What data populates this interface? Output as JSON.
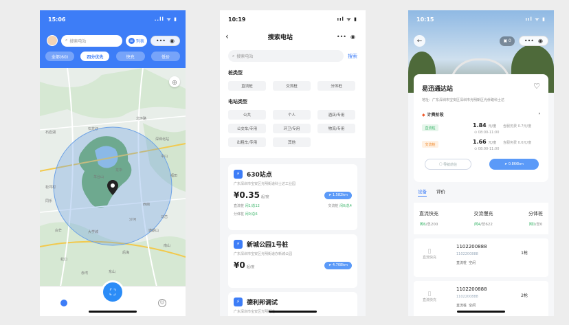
{
  "phone1": {
    "time": "15:06",
    "signal": "..ll ᯤ ▮",
    "search_placeholder": "搜索电站",
    "list_label": "列表",
    "tabs": [
      "全部(60)",
      "四分优先",
      "快充",
      "低价"
    ],
    "map_labels": [
      "石岩湖",
      "石龙仔",
      "北环路",
      "深圳北站",
      "平山",
      "西丽",
      "大学城",
      "塘朗山",
      "南山",
      "同乐",
      "蛇口",
      "赤湾",
      "白芒",
      "羊台山",
      "福田",
      "龙华",
      "沙河",
      "后海",
      "松坪村",
      "东山",
      "马峦"
    ],
    "nav_left": "首页",
    "nav_right": "我的"
  },
  "phone2": {
    "time": "10:19",
    "signal": "ııl ᯤ ▮",
    "title": "搜索电站",
    "search_placeholder": "搜索电站",
    "search_btn": "搜索",
    "pile_type_title": "桩类型",
    "pile_types": [
      "直流桩",
      "交流桩",
      "分体桩"
    ],
    "station_type_title": "电站类型",
    "station_types": [
      "公共",
      "个人",
      "酒店/专用",
      "公交车/专用",
      "环卫/专用",
      "物流/专用",
      "出租车/专用",
      "其他"
    ],
    "cards": [
      {
        "name": "630站点",
        "addr": "广东深圳市宝安区光明街道科士达工业园",
        "price": "¥0.35",
        "unit": "起/度",
        "nav": "1.582km",
        "dc": "直流桩",
        "dc_val": "闲1/总12",
        "ac": "交流桩",
        "ac_val": "闲0/总4",
        "split": "分体桩",
        "split_val": "闲0/总6"
      },
      {
        "name": "新城公园1号桩",
        "addr": "广东深圳市宝安区光明街道办新城公园",
        "price": "¥0",
        "unit": "起/度",
        "nav": "4.708km"
      },
      {
        "name": "德利邦调试",
        "addr": "广东深圳市宝安区光明街道"
      }
    ]
  },
  "phone3": {
    "time": "10:15",
    "signal": "ııl ᯤ ▮",
    "img_count": "0",
    "station_name": "易迅通达站",
    "address": "地址：广东深圳市宝安区深圳市光明新区光侨路科士达",
    "fee_label": "计费阶段",
    "prices": [
      {
        "badge": "直流桩",
        "price": "1.84",
        "unit": "元/度",
        "service": "含服务费 0.7元/度",
        "time": "08:00-11:00"
      },
      {
        "badge": "交流桩",
        "price": "1.66",
        "unit": "元/度",
        "service": "含服务费 0.6元/度",
        "time": "08:00-11:00"
      }
    ],
    "btn_left": "导航前往",
    "btn_right": "0.866km",
    "tabs": [
      "设备",
      "评价"
    ],
    "stats": [
      {
        "label": "直流快充",
        "val_hl": "闲6",
        "val": "/总200"
      },
      {
        "label": "交流慢充",
        "val_hl": "闲4",
        "val": "/总622"
      },
      {
        "label": "分体桩",
        "val_hl": "闲0",
        "val": "/总0"
      }
    ],
    "piles": [
      {
        "no": "1102200888",
        "sub": "1102200888",
        "type": "直流桩",
        "status": "空闲",
        "guns": "1枪",
        "icon_label": "直流快充"
      },
      {
        "no": "1102200888",
        "sub": "1102200888",
        "type": "直流桩",
        "status": "空闲",
        "guns": "2枪",
        "icon_label": "直流快充"
      }
    ]
  }
}
